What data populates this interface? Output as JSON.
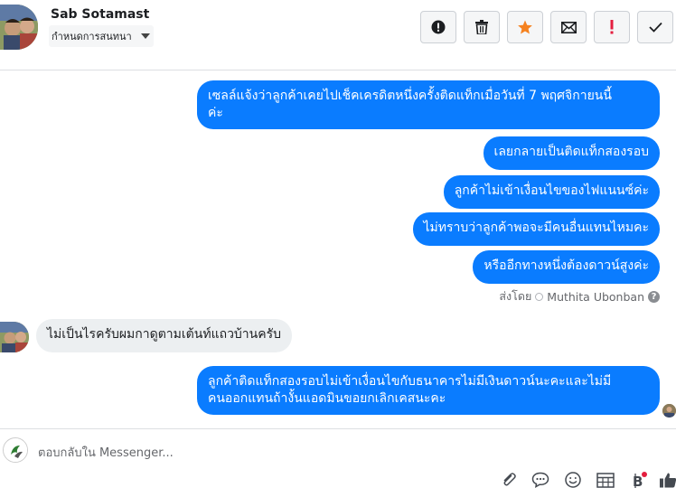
{
  "header": {
    "contact_name": "Sab Sotamast",
    "label_placeholder": "กำหนดการสนทนา",
    "actions": [
      "alert",
      "delete",
      "star",
      "mail",
      "mark",
      "done"
    ]
  },
  "messages": [
    {
      "dir": "out",
      "lines": [
        "เซลล์แจ้งว่าลูกค้าเคยไปเช็คเครดิตหนึ่งครั้งติดแท็กเมื่อวันที่ 7 พฤศจิกายนนี้",
        "ค่ะ"
      ]
    },
    {
      "dir": "out",
      "text": "เลยกลายเป็นติดแท็กสองรอบ"
    },
    {
      "dir": "out",
      "text": "ลูกค้าไม่เข้าเงื่อนไขของไฟแนนซ์ค่ะ"
    },
    {
      "dir": "out",
      "text": "ไม่ทราบว่าลูกค้าพอจะมีคนอื่นแทนไหมคะ"
    },
    {
      "dir": "out",
      "text": "หรืออีกทางหนึ่งต้องดาวน์สูงค่ะ"
    },
    {
      "dir": "in",
      "text": "ไม่เป็นไรครับผมกาดูตามเต้นท์แถวบ้านครับ"
    },
    {
      "dir": "out",
      "lines": [
        "ลูกค้าติดแท็กสองรอบไม่เข้าเงื่อนไขกับธนาคารไม่มีเงินดาวน์นะคะและไม่มี",
        "คนออกแทนถ้างั้นแอดมินขอยกเลิกเคสนะคะ"
      ]
    }
  ],
  "sent_by": {
    "prefix": "ส่งโดย",
    "name": "Muthita Ubonban",
    "help": "?"
  },
  "footer": {
    "reply_placeholder": "ตอบกลับใน Messenger...",
    "icons": [
      "attach-icon",
      "saved-reply-icon",
      "emoji-icon",
      "calendar-icon",
      "bitcoin-icon",
      "like-icon"
    ]
  },
  "colors": {
    "outgoing": "#0a7cff",
    "incoming": "#eceff1",
    "star": "#f58220",
    "mark": "#e41e3f"
  }
}
